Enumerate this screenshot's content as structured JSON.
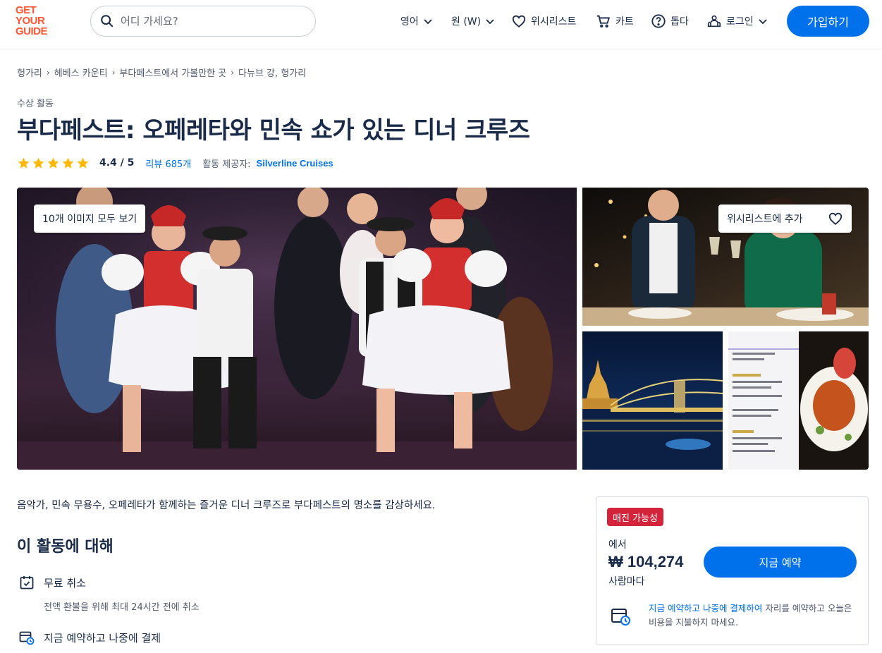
{
  "header": {
    "logo_lines": [
      "GET",
      "YOUR",
      "GUIDE"
    ],
    "search_placeholder": "어디 가세요?",
    "language_label": "영어",
    "currency_label": "원 (W)",
    "wishlist_label": "위시리스트",
    "cart_label": "카트",
    "help_label": "돕다",
    "login_label": "로그인",
    "signup_label": "가입하기"
  },
  "breadcrumb": [
    "헝가리",
    "헤베스 카운티",
    "부다페스트에서 가볼만한 곳",
    "다뉴브 강, 헝가리"
  ],
  "category": "수상 활동",
  "title": "부다페스트: 오페레타와 민속 쇼가 있는 디너 크루즈",
  "rating": {
    "stars": 5,
    "value": "4.4 / 5",
    "reviews": "리뷰 685개",
    "provider_label": "활동 제공자:",
    "provider": "Silverline Cruises"
  },
  "gallery": {
    "view_all_label": "10개 이미지 모두 보기",
    "add_wishlist_label": "위시리스트에 추가"
  },
  "summary": "음악가, 민속 무용수, 오페레타가 함께하는 즐거운 디너 크루즈로 부다페스트의 명소를 감상하세요.",
  "about": {
    "title": "이 활동에 대해",
    "free_cancel_title": "무료 취소",
    "free_cancel_desc": "전액 환불을 위해 최대 24시간 전에 취소",
    "reserve_title": "지금 예약하고 나중에 결제"
  },
  "booking": {
    "badge": "매진 가능성",
    "from_label": "에서",
    "price": "₩ 104,274",
    "per_person": "사람마다",
    "book_label": "지금 예약",
    "rnpl_link": "지금 예약하고 나중에 결제하여",
    "rnpl_rest": " 자리를 예약하고 오늘은 비용을 지불하지 마세요."
  },
  "colors": {
    "brand_orange": "#ff5533",
    "primary_blue": "#0071eb",
    "badge_red": "#d3243c",
    "star_yellow": "#ffb800",
    "text_dark": "#1a2b49"
  }
}
